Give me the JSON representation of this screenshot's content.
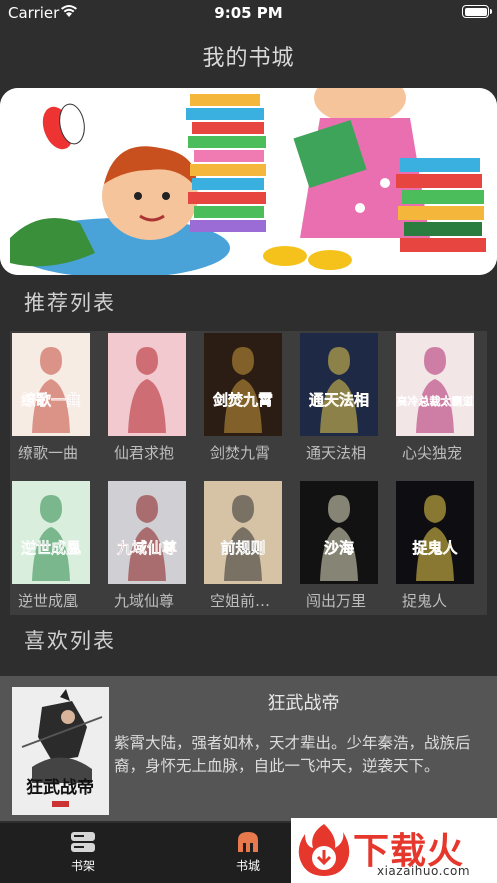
{
  "status_bar": {
    "carrier": "Carrier",
    "time": "9:05 PM"
  },
  "nav": {
    "title": "我的书城"
  },
  "recommend": {
    "heading": "推荐列表",
    "books": [
      {
        "title": "缭歌一曲",
        "cover_text": "缭歌一曲",
        "bg": "#f6ece4",
        "accent": "#c44b3c"
      },
      {
        "title": "仙君求抱",
        "cover_text": "",
        "bg": "#f1c9cf",
        "accent": "#b3202b"
      },
      {
        "title": "剑焚九霄",
        "cover_text": "剑焚九霄",
        "bg": "#2b1c14",
        "accent": "#c99a3a"
      },
      {
        "title": "通天法相",
        "cover_text": "通天法相",
        "bg": "#1e2a45",
        "accent": "#e7c94a"
      },
      {
        "title": "心尖独宠",
        "cover_text": "高冷总裁太霸道",
        "bg": "#f2e6e6",
        "accent": "#b0286d"
      },
      {
        "title": "逆世成凰",
        "cover_text": "逆世成凰",
        "bg": "#d9eedc",
        "accent": "#2c8a4c"
      },
      {
        "title": "九域仙尊",
        "cover_text": "九域仙尊",
        "bg": "#cfcfd4",
        "accent": "#8b1d1d"
      },
      {
        "title": "空姐前规则",
        "cover_text": "前规则",
        "bg": "#d6c3a6",
        "accent": "#2d2d2d"
      },
      {
        "title": "闯出万里",
        "cover_text": "沙海",
        "bg": "#121212",
        "accent": "#e6e1c4"
      },
      {
        "title": "捉鬼人",
        "cover_text": "捉鬼人",
        "bg": "#0d0d12",
        "accent": "#f0d24a"
      }
    ]
  },
  "favorites": {
    "heading": "喜欢列表",
    "item": {
      "title": "狂武战帝",
      "cover_text": "狂武战帝",
      "description": "紫霄大陆，强者如林，天才辈出。少年秦浩，战族后裔，身怀无上血脉，自此一飞冲天，逆袭天下。"
    }
  },
  "tabs": [
    {
      "label": "书架",
      "icon": "bookshelf-icon"
    },
    {
      "label": "书城",
      "icon": "bookstore-icon"
    }
  ],
  "watermark": {
    "main": "下载火",
    "sub": "xiazaihuo.com"
  },
  "colors": {
    "background": "#2e2e2e",
    "panel": "#3d3d3d",
    "fav_bg": "#555555",
    "tab_bg": "#1f1f1f",
    "active_tab": "#e8794c"
  }
}
